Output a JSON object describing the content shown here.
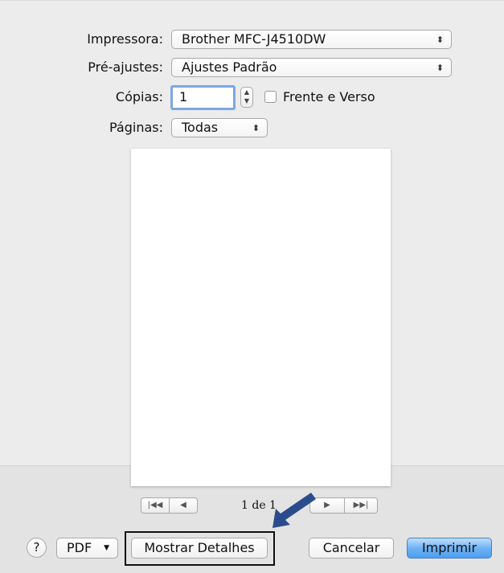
{
  "form": {
    "printer_label": "Impressora:",
    "printer_value": "Brother MFC-J4510DW",
    "presets_label": "Pré-ajustes:",
    "presets_value": "Ajustes Padrão",
    "copies_label": "Cópias:",
    "copies_value": "1",
    "duplex_label": "Frente e Verso",
    "duplex_checked": false,
    "pages_label": "Páginas:",
    "pages_value": "Todas"
  },
  "preview": {
    "page_count": "1 de 1"
  },
  "footer": {
    "help_label": "?",
    "pdf_label": "PDF",
    "details_label": "Mostrar Detalhes",
    "cancel_label": "Cancelar",
    "print_label": "Imprimir"
  },
  "colors": {
    "dialog_bg": "#ececec",
    "focus_ring": "#7ba7e1",
    "primary_button": "#4f9ef1",
    "annotation_arrow": "#2b4c8c"
  },
  "icons": {
    "popup": "chevron-up-down-icon",
    "stepper": "stepper-icon",
    "help": "question-icon",
    "pager_first": "first-page-icon",
    "pager_prev": "previous-page-icon",
    "pager_next": "next-page-icon",
    "pager_last": "last-page-icon",
    "annotation": "callout-arrow-icon"
  }
}
